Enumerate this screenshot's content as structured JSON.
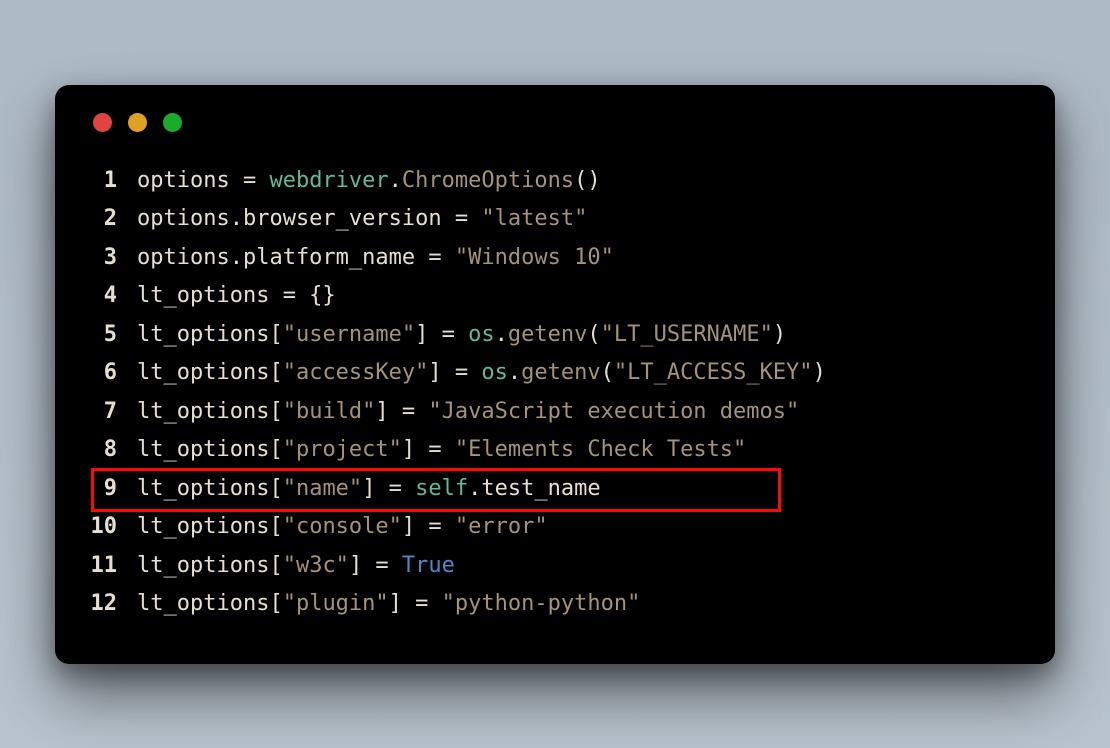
{
  "lines": [
    {
      "n": "1",
      "tokens": [
        {
          "c": "t-plain",
          "t": "options = "
        },
        {
          "c": "t-ident",
          "t": "webdriver"
        },
        {
          "c": "t-plain",
          "t": "."
        },
        {
          "c": "t-class",
          "t": "ChromeOptions"
        },
        {
          "c": "t-plain",
          "t": "()"
        }
      ]
    },
    {
      "n": "2",
      "tokens": [
        {
          "c": "t-plain",
          "t": "options.browser_version = "
        },
        {
          "c": "t-string",
          "t": "\"latest\""
        }
      ]
    },
    {
      "n": "3",
      "tokens": [
        {
          "c": "t-plain",
          "t": "options.platform_name = "
        },
        {
          "c": "t-string",
          "t": "\"Windows 10\""
        }
      ]
    },
    {
      "n": "4",
      "tokens": [
        {
          "c": "t-plain",
          "t": "lt_options = {}"
        }
      ]
    },
    {
      "n": "5",
      "tokens": [
        {
          "c": "t-plain",
          "t": "lt_options["
        },
        {
          "c": "t-string",
          "t": "\"username\""
        },
        {
          "c": "t-plain",
          "t": "] = "
        },
        {
          "c": "t-ident",
          "t": "os"
        },
        {
          "c": "t-plain",
          "t": "."
        },
        {
          "c": "t-func",
          "t": "getenv"
        },
        {
          "c": "t-plain",
          "t": "("
        },
        {
          "c": "t-string",
          "t": "\"LT_USERNAME\""
        },
        {
          "c": "t-plain",
          "t": ")"
        }
      ]
    },
    {
      "n": "6",
      "tokens": [
        {
          "c": "t-plain",
          "t": "lt_options["
        },
        {
          "c": "t-string",
          "t": "\"accessKey\""
        },
        {
          "c": "t-plain",
          "t": "] = "
        },
        {
          "c": "t-ident",
          "t": "os"
        },
        {
          "c": "t-plain",
          "t": "."
        },
        {
          "c": "t-func",
          "t": "getenv"
        },
        {
          "c": "t-plain",
          "t": "("
        },
        {
          "c": "t-string",
          "t": "\"LT_ACCESS_KEY\""
        },
        {
          "c": "t-plain",
          "t": ")"
        }
      ]
    },
    {
      "n": "7",
      "tokens": [
        {
          "c": "t-plain",
          "t": "lt_options["
        },
        {
          "c": "t-string",
          "t": "\"build\""
        },
        {
          "c": "t-plain",
          "t": "] = "
        },
        {
          "c": "t-string",
          "t": "\"JavaScript execution demos\""
        }
      ]
    },
    {
      "n": "8",
      "tokens": [
        {
          "c": "t-plain",
          "t": "lt_options["
        },
        {
          "c": "t-string",
          "t": "\"project\""
        },
        {
          "c": "t-plain",
          "t": "] = "
        },
        {
          "c": "t-string",
          "t": "\"Elements Check Tests\""
        }
      ]
    },
    {
      "n": "9",
      "highlight": true,
      "tokens": [
        {
          "c": "t-plain",
          "t": "lt_options["
        },
        {
          "c": "t-string",
          "t": "\"name\""
        },
        {
          "c": "t-plain",
          "t": "] = "
        },
        {
          "c": "t-ident",
          "t": "self"
        },
        {
          "c": "t-plain",
          "t": ".test_name"
        }
      ]
    },
    {
      "n": "10",
      "tokens": [
        {
          "c": "t-plain",
          "t": "lt_options["
        },
        {
          "c": "t-string",
          "t": "\"console\""
        },
        {
          "c": "t-plain",
          "t": "] = "
        },
        {
          "c": "t-string",
          "t": "\"error\""
        }
      ]
    },
    {
      "n": "11",
      "tokens": [
        {
          "c": "t-plain",
          "t": "lt_options["
        },
        {
          "c": "t-string",
          "t": "\"w3c\""
        },
        {
          "c": "t-plain",
          "t": "] = "
        },
        {
          "c": "t-kw",
          "t": "True"
        }
      ]
    },
    {
      "n": "12",
      "tokens": [
        {
          "c": "t-plain",
          "t": "lt_options["
        },
        {
          "c": "t-string",
          "t": "\"plugin\""
        },
        {
          "c": "t-plain",
          "t": "] = "
        },
        {
          "c": "t-string",
          "t": "\"python-python\""
        }
      ]
    }
  ]
}
